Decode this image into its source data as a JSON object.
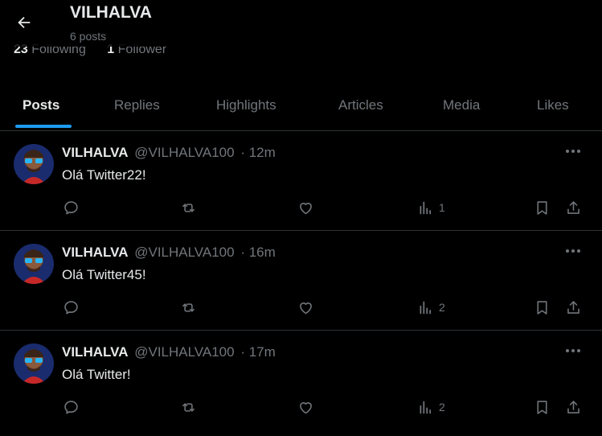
{
  "header": {
    "title": "VILHALVA",
    "post_count": "6 posts"
  },
  "profile": {
    "following_count": "23",
    "following_label": "Following",
    "followers_count": "1",
    "followers_label": "Follower"
  },
  "tabs": [
    {
      "label": "Posts",
      "active": true
    },
    {
      "label": "Replies"
    },
    {
      "label": "Highlights"
    },
    {
      "label": "Articles"
    },
    {
      "label": "Media"
    },
    {
      "label": "Likes"
    }
  ],
  "posts": [
    {
      "name": "VILHALVA",
      "handle": "@VILHALVA100",
      "time": "· 12m",
      "text": "Olá Twitter22!",
      "views": "1"
    },
    {
      "name": "VILHALVA",
      "handle": "@VILHALVA100",
      "time": "· 16m",
      "text": "Olá Twitter45!",
      "views": "2"
    },
    {
      "name": "VILHALVA",
      "handle": "@VILHALVA100",
      "time": "· 17m",
      "text": "Olá Twitter!",
      "views": "2"
    }
  ],
  "colors": {
    "background": "#000000",
    "accent": "#1d9bf0",
    "muted_text": "#71767b",
    "primary_text": "#e7e9ea",
    "divider": "#2f3336"
  },
  "icons": [
    "back-arrow-icon",
    "more-icon",
    "reply-icon",
    "repost-icon",
    "like-icon",
    "views-icon",
    "bookmark-icon",
    "share-icon"
  ]
}
